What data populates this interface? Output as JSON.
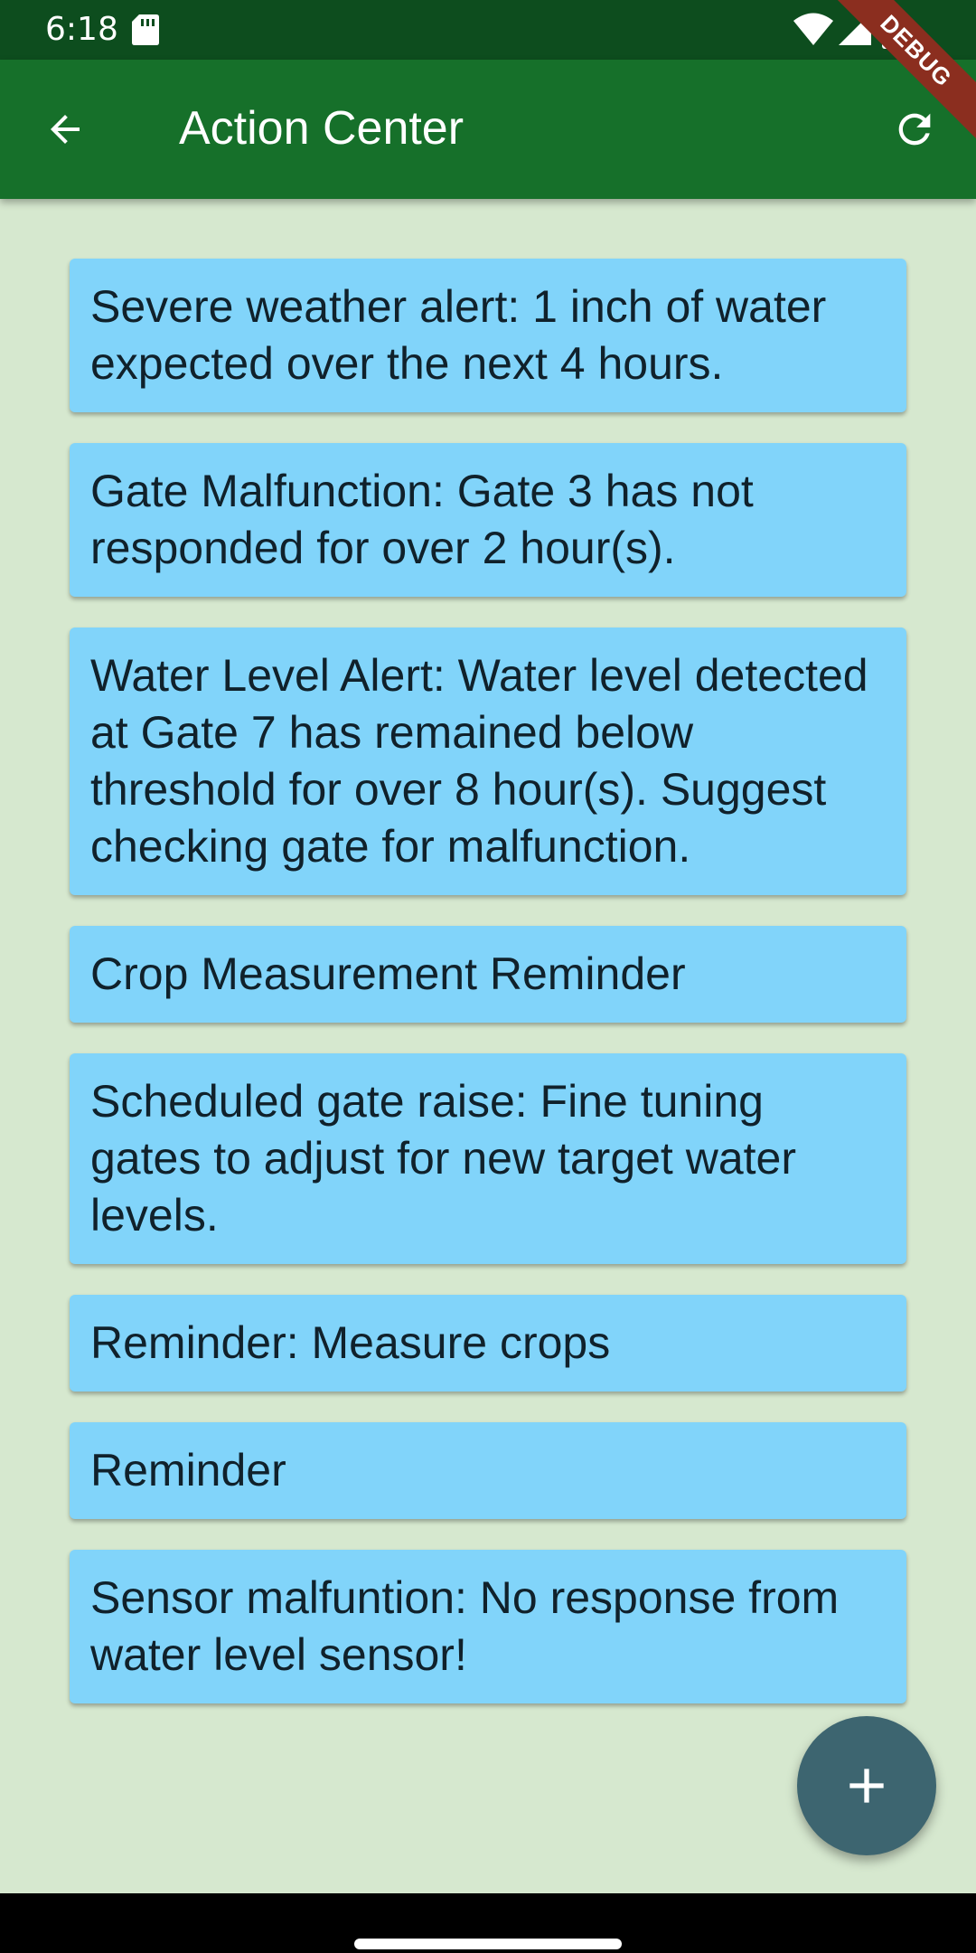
{
  "status_bar": {
    "time": "6:18",
    "icons": [
      "sd-card-icon",
      "wifi-icon",
      "cell-signal-icon",
      "battery-icon"
    ]
  },
  "debug_banner": "DEBUG",
  "app_bar": {
    "title": "Action Center",
    "back_icon": "arrow-back-icon",
    "refresh_icon": "refresh-icon",
    "background_color": "#16702a"
  },
  "notifications": [
    {
      "text": "Severe weather alert: 1 inch of water expected over the next 4 hours."
    },
    {
      "text": "Gate Malfunction: Gate 3 has not responded for over 2 hour(s)."
    },
    {
      "text": "Water Level Alert: Water level detected at Gate 7 has remained below threshold for over 8 hour(s). Suggest checking gate for malfunction."
    },
    {
      "text": "Crop Measurement Reminder"
    },
    {
      "text": "Scheduled gate raise: Fine tuning gates to adjust for new target water levels."
    },
    {
      "text": "Reminder: Measure crops"
    },
    {
      "text": "Reminder"
    },
    {
      "text": "Sensor malfuntion: No response from water level sensor!"
    }
  ],
  "fab": {
    "icon": "plus-icon",
    "color": "#3d6570"
  },
  "colors": {
    "page_background": "#d6e8cf",
    "card_background": "#81d4fa",
    "status_bar": "#0d4d1e"
  }
}
